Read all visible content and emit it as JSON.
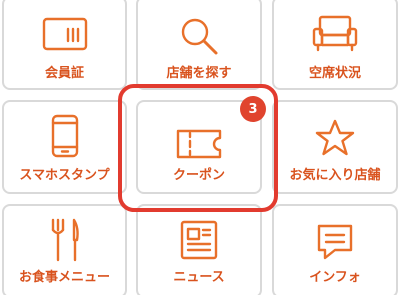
{
  "menu": {
    "tiles": [
      {
        "label": "会員証",
        "icon": "membership-card-icon"
      },
      {
        "label": "店舗を探す",
        "icon": "search-icon"
      },
      {
        "label": "空席状況",
        "icon": "sofa-icon"
      },
      {
        "label": "スマホスタンプ",
        "icon": "smartphone-icon"
      },
      {
        "label": "クーポン",
        "icon": "ticket-icon",
        "badge": "3"
      },
      {
        "label": "お気に入り店舗",
        "icon": "star-icon"
      },
      {
        "label": "お食事メニュー",
        "icon": "fork-knife-icon"
      },
      {
        "label": "ニュース",
        "icon": "newspaper-icon"
      },
      {
        "label": "インフォ",
        "icon": "chat-bubble-icon"
      }
    ]
  },
  "colors": {
    "accent": "#e8702a",
    "label": "#d9531e",
    "highlight": "#e23b2f",
    "badge": "#e0442e",
    "border": "#d9d9d9"
  }
}
